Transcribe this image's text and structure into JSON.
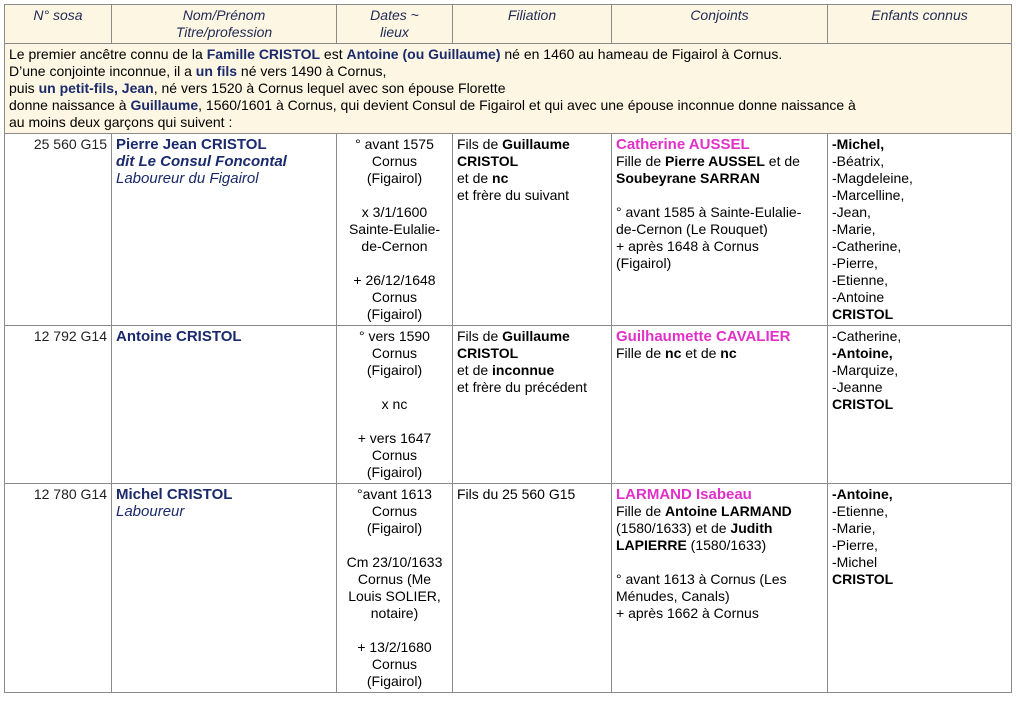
{
  "headers": [
    "N° sosa",
    "Nom/Prénom\nTitre/profession",
    "Dates ~\nlieux",
    "Filiation",
    "Conjoints",
    "Enfants connus"
  ],
  "header_lines": {
    "sosa": "N° sosa",
    "name1": "Nom/Prénom",
    "name2": "Titre/profession",
    "dates1": "Dates ~",
    "dates2": "lieux",
    "filiation": "Filiation",
    "conjoints": "Conjoints",
    "enfants": "Enfants connus"
  },
  "intro": {
    "l1a": "Le premier ancêtre connu de la ",
    "l1b": "Famille CRISTOL",
    "l1c": " est ",
    "l1d": "Antoine (ou Guillaume)",
    "l1e": " né en 1460 au hameau de Figairol à Cornus.",
    "l2a": "D’une conjointe inconnue, il a ",
    "l2b": "un fils",
    "l2c": " né vers 1490 à Cornus,",
    "l3a": "puis ",
    "l3b": "un petit-fils, Jean",
    "l3c": ", né vers 1520 à Cornus lequel avec son épouse Florette",
    "l4a": "donne naissance à ",
    "l4b": "Guillaume",
    "l4c": ", 1560/1601 à Cornus, qui devient Consul de Figairol et qui avec une épouse inconnue donne naissance à",
    "l5": "au moins deux garçons qui suivent :"
  },
  "rows": [
    {
      "sosa": "25 560 G15",
      "name": "Pierre Jean CRISTOL",
      "alias": "dit Le Consul Foncontal",
      "title": "Laboureur du Figairol",
      "dates": [
        "° avant 1575",
        "Cornus",
        "(Figairol)",
        "",
        "x 3/1/1600",
        "Sainte-Eulalie-",
        "de-Cernon",
        "",
        "+ 26/12/1648",
        "Cornus",
        "(Figairol)"
      ],
      "filiation": {
        "a": "Fils de ",
        "b": "Guillaume CRISTOL",
        "c": "et de ",
        "d": "nc",
        "e": "et frère du suivant"
      },
      "spouse": "Catherine AUSSEL",
      "spouse_parents": {
        "a": "Fille de ",
        "b": "Pierre AUSSEL",
        "c": " et de ",
        "d": "Soubeyrane SARRAN"
      },
      "spouse_info": [
        "° avant 1585 à Sainte-Eulalie-",
        "de-Cernon (Le Rouquet)",
        "+ après 1648 à Cornus",
        "(Figairol)"
      ],
      "children": [
        "-Michel,",
        "-Béatrix,",
        "-Magdeleine,",
        "-Marcelline,",
        "-Jean,",
        "-Marie,",
        "-Catherine,",
        "-Pierre,",
        "-Etienne,",
        "-Antoine",
        "CRISTOL"
      ]
    },
    {
      "sosa": "12 792 G14",
      "name": "Antoine CRISTOL",
      "dates": [
        "° vers 1590",
        "Cornus",
        "(Figairol)",
        "",
        "x nc",
        "",
        "+ vers 1647",
        "Cornus",
        "(Figairol)"
      ],
      "filiation": {
        "a": "Fils de ",
        "b": "Guillaume CRISTOL",
        "c": "et de ",
        "d": "inconnue",
        "e": "et frère du précédent"
      },
      "spouse": "Guilhaumette CAVALIER",
      "spouse_parents": {
        "a": "Fille de ",
        "b": "nc",
        "c": " et de ",
        "d": "nc"
      },
      "children": [
        "-Catherine,",
        "-Antoine,",
        "-Marquize,",
        "-Jeanne",
        "CRISTOL"
      ]
    },
    {
      "sosa": "12 780 G14",
      "name": "Michel CRISTOL",
      "title": "Laboureur",
      "dates": [
        "°avant 1613",
        "Cornus",
        "(Figairol)",
        "",
        "Cm 23/10/1633",
        "Cornus (Me",
        "Louis SOLIER,",
        "notaire)",
        "",
        "+ 13/2/1680",
        "Cornus",
        "(Figairol)"
      ],
      "filiation_plain": "Fils du 25 560 G15",
      "spouse": "LARMAND Isabeau",
      "spouse_parents3": {
        "a": "Fille de ",
        "b": "Antoine LARMAND",
        "c": "(1580/1633) et de ",
        "d": "Judith LAPIERRE",
        "e": " (1580/1633)"
      },
      "spouse_info": [
        "° avant 1613 à Cornus (Les",
        "Ménudes, Canals)",
        "+ après 1662 à Cornus"
      ],
      "children": [
        "-Antoine,",
        "-Etienne,",
        "-Marie,",
        "-Pierre,",
        "-Michel",
        "CRISTOL"
      ]
    }
  ]
}
